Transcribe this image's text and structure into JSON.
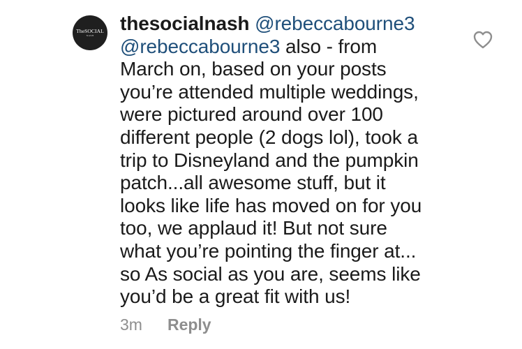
{
  "comment": {
    "avatar_text": "TheSOCIAL",
    "avatar_subtext": "NASH",
    "username": "thesocialnash",
    "mention_1": "@rebeccabourne3",
    "mention_2": "@rebeccabourne3",
    "lines": {
      "l2_rest": " also - from",
      "l3": "March on, based on your posts",
      "l4": "you’re attended multiple weddings,",
      "l5": "were pictured around over 100",
      "l6": "different people (2 dogs lol), took a",
      "l7": "trip to Disneyland and the pumpkin",
      "l8": "patch...all awesome stuff, but it",
      "l9": "looks like life has moved on for you",
      "l10": "too, we applaud it! But not sure",
      "l11": "what you’re pointing the finger at...",
      "l12": "so As social as you are, seems like",
      "l13": "you’d be a great fit with us!"
    },
    "timestamp": "3m",
    "reply_label": "Reply",
    "like_icon": "heart-outline-icon"
  },
  "colors": {
    "text": "#1a1a1a",
    "mention": "#1f4f7a",
    "meta": "#8e8e8e",
    "avatar_bg": "#1f1f1f"
  }
}
